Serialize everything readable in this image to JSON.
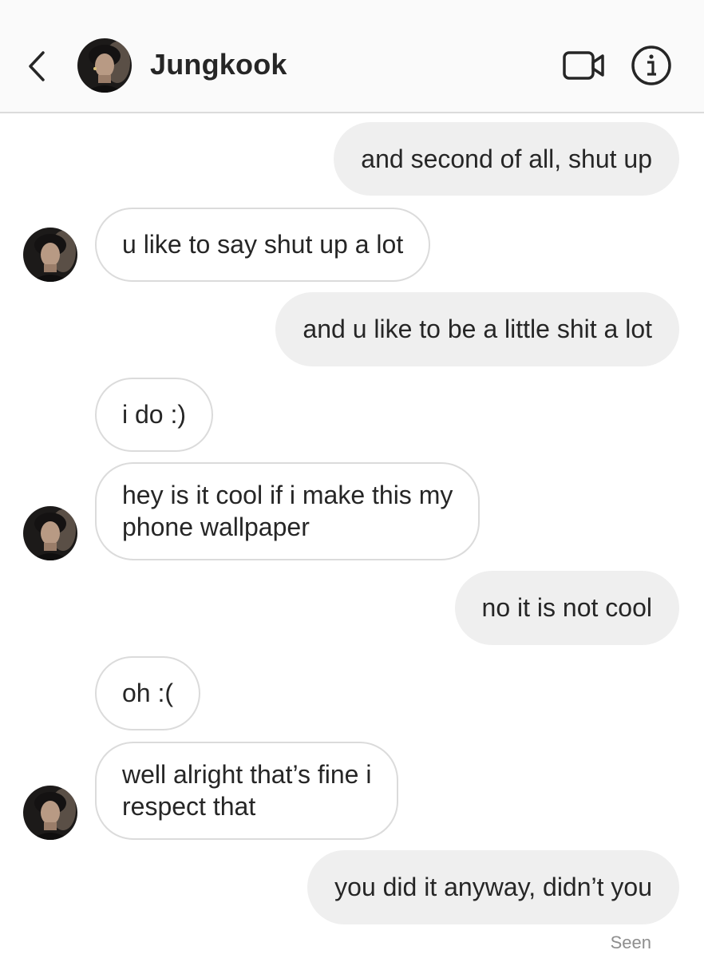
{
  "header": {
    "contact_name": "Jungkook",
    "back_icon": "chevron-left-icon",
    "video_icon": "video-camera-icon",
    "info_icon": "info-icon"
  },
  "messages": [
    {
      "direction": "outgoing",
      "text": "and second of all, shut up"
    },
    {
      "direction": "incoming",
      "text": "u like to say shut up a lot",
      "avatar": true
    },
    {
      "direction": "outgoing",
      "text": "and u like to be a little shit a lot"
    },
    {
      "direction": "incoming",
      "text": "i do :)",
      "avatar": false
    },
    {
      "direction": "incoming",
      "lines": [
        "hey is it cool if i make this my",
        "phone wallpaper"
      ],
      "avatar": true
    },
    {
      "direction": "outgoing",
      "text": "no it is not cool"
    },
    {
      "direction": "incoming",
      "text": "oh :(",
      "avatar": false
    },
    {
      "direction": "incoming",
      "lines": [
        "well alright that’s fine i",
        "respect that"
      ],
      "avatar": true
    },
    {
      "direction": "outgoing",
      "text": "you did it anyway, didn’t you"
    }
  ],
  "status": {
    "seen_label": "Seen"
  },
  "colors": {
    "outgoing_bubble": "#efefef",
    "incoming_border": "#dbdbdb",
    "header_background": "#fafafa",
    "text": "#262626",
    "muted": "#8e8e8e"
  }
}
